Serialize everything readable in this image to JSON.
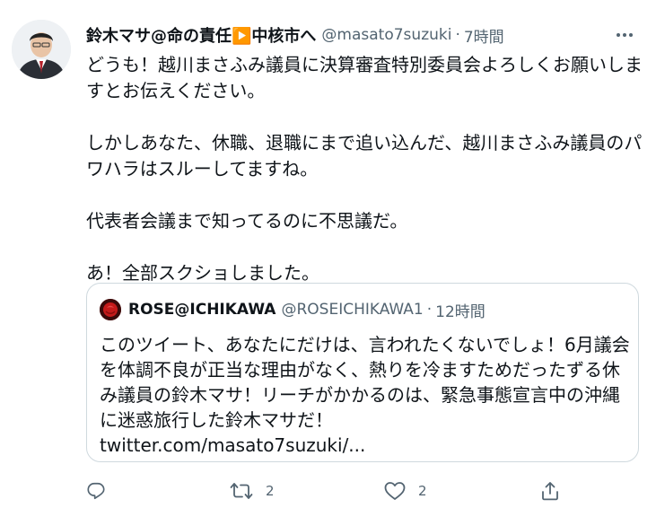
{
  "tweet": {
    "author_name": "鈴木マサ@命の責任▶️中核市へ",
    "author_handle": "@masato7suzuki",
    "separator": "·",
    "time": "7時間",
    "paragraphs": [
      "どうも！越川まさふみ議員に決算審査特別委員会よろしくお願いしますとお伝えください。",
      "しかしあなた、休職、退職にまで追い込んだ、越川まさふみ議員のパワハラはスルーしてますね。",
      "代表者会議まで知ってるのに不思議だ。",
      "あ！全部スクショしました。"
    ]
  },
  "quoted": {
    "author_name": "ROSE@ICHIKAWA",
    "author_handle": "@ROSEICHIKAWA1",
    "separator": "·",
    "time": "12時間",
    "text": "このツイート、あなたにだけは、言われたくないでしょ！6月議会を体調不良が正当な理由がなく、熱りを冷ますためだったずる休み議員の鈴木マサ！リーチがかかるのは、緊急事態宣言中の沖縄に迷惑旅行した鈴木マサだ！",
    "link": "twitter.com/masato7suzuki/..."
  },
  "actions": {
    "reply_count": "",
    "retweet_count": "2",
    "like_count": "2",
    "share_count": ""
  },
  "icons": [
    "more-icon",
    "reply-icon",
    "retweet-icon",
    "like-icon",
    "share-icon"
  ],
  "colors": {
    "text": "#0f1419",
    "secondary": "#536471",
    "border": "#cfd9de"
  }
}
